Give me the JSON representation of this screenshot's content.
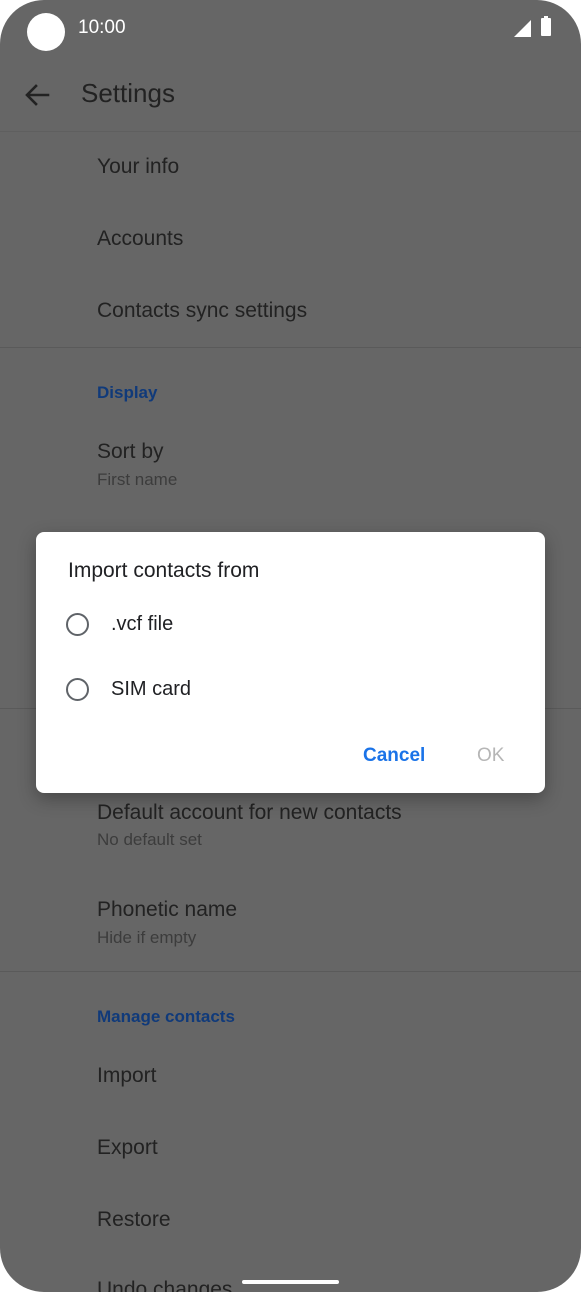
{
  "status_bar": {
    "time": "10:00"
  },
  "appbar": {
    "title": "Settings",
    "back_icon": "arrow-back-icon"
  },
  "settings": {
    "your_info": "Your info",
    "accounts": "Accounts",
    "contacts_sync": "Contacts sync settings",
    "display_header": "Display",
    "sort_by": {
      "title": "Sort by",
      "value": "First name"
    },
    "default_account": {
      "title": "Default account for new contacts",
      "value": "No default set"
    },
    "phonetic_name": {
      "title": "Phonetic name",
      "value": "Hide if empty"
    },
    "manage_header": "Manage contacts",
    "import": "Import",
    "export": "Export",
    "restore": "Restore",
    "undo_changes": "Undo changes"
  },
  "dialog": {
    "title": "Import contacts from",
    "options": [
      {
        "label": ".vcf file",
        "selected": false
      },
      {
        "label": "SIM card",
        "selected": false
      }
    ],
    "cancel_label": "Cancel",
    "ok_label": "OK"
  },
  "colors": {
    "scrim_background": "#666666",
    "section_header": "#103a7a",
    "accent": "#1a73e8",
    "disabled": "#b6b6b6"
  }
}
